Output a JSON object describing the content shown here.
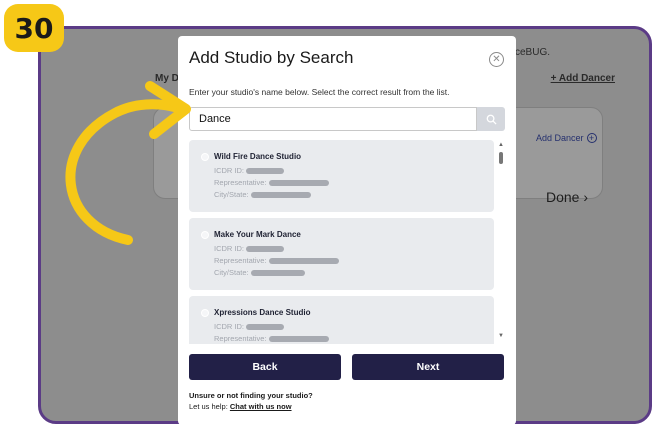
{
  "step": {
    "number": "30"
  },
  "background": {
    "brand_text": "ceBUG.",
    "my_dancers_label": "My Da",
    "add_dancer_link": "+ Add Dancer",
    "add_dancer_button": "Add Dancer",
    "done_label": "Done"
  },
  "modal": {
    "title": "Add Studio by Search",
    "close_icon": "close-icon",
    "instructions": "Enter your studio's name below. Select the correct result from the list.",
    "search": {
      "value": "Dance",
      "placeholder": ""
    },
    "field_labels": {
      "icdr_id": "ICDR ID:",
      "representative": "Representative:",
      "city_state": "City/State:"
    },
    "results": [
      {
        "name": "Wild Fire Dance Studio"
      },
      {
        "name": "Make Your Mark Dance"
      },
      {
        "name": "Xpressions Dance Studio"
      }
    ],
    "back_label": "Back",
    "next_label": "Next",
    "help_question": "Unsure or not finding your studio?",
    "help_prefix": "Let us help: ",
    "help_link": "Chat with us now"
  },
  "colors": {
    "badge": "#f6c817",
    "frame_border": "#5b3b86",
    "button": "#222047",
    "arrow": "#f6c817"
  }
}
